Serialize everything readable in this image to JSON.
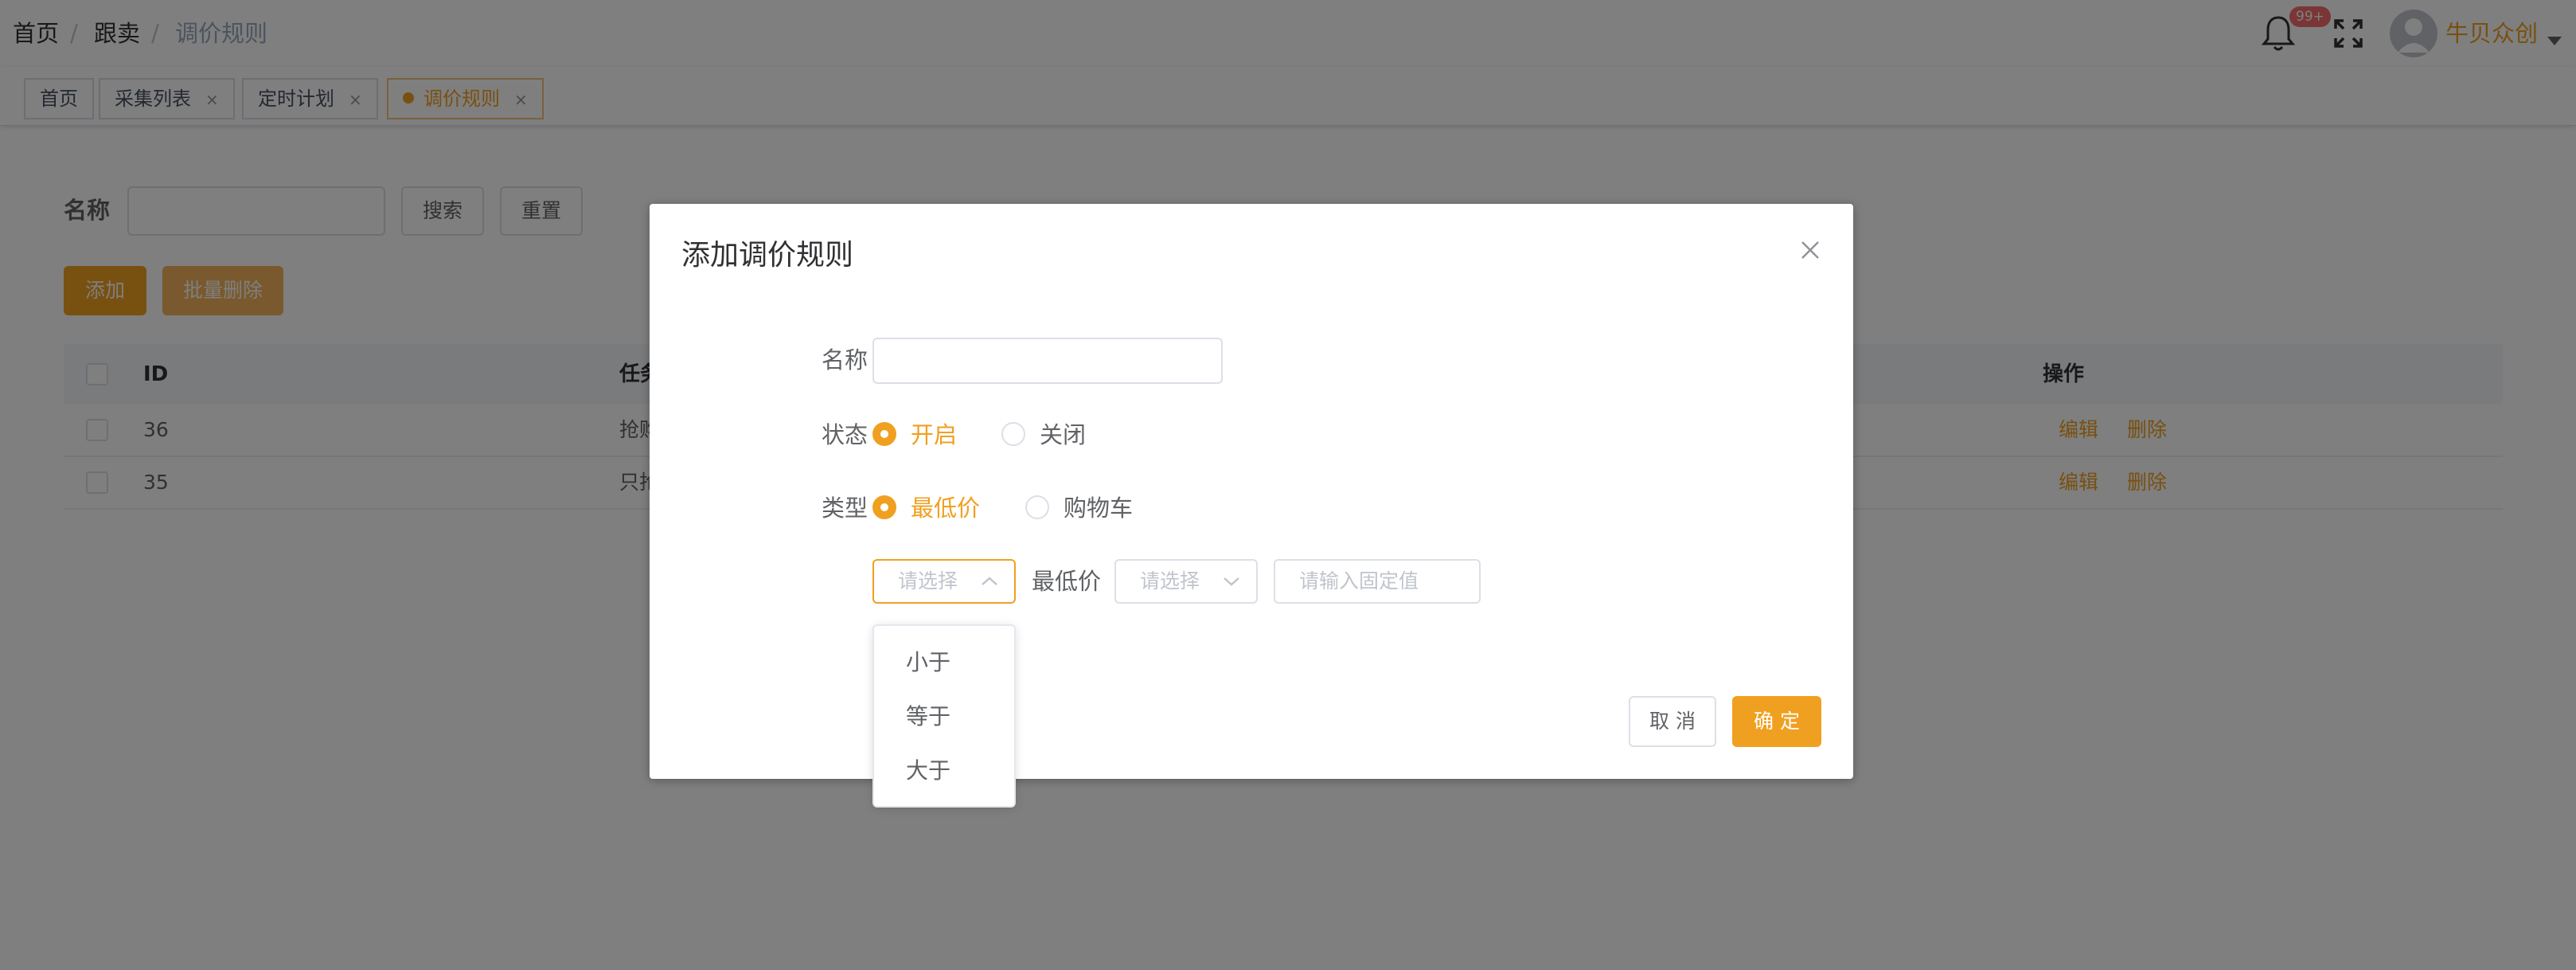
{
  "breadcrumb": {
    "home": "首页",
    "parent": "跟卖",
    "current": "调价规则",
    "separator": "/"
  },
  "header": {
    "notification_badge": "99+",
    "user_name": "牛贝众创"
  },
  "tags": [
    {
      "label": "首页"
    },
    {
      "label": "采集列表",
      "close": "×"
    },
    {
      "label": "定时计划",
      "close": "×"
    },
    {
      "label": "调价规则",
      "close": "×"
    }
  ],
  "filter": {
    "name_label": "名称",
    "name_value": "",
    "search_button": "搜索",
    "reset_button": "重置"
  },
  "toolbar": {
    "add_button": "添加",
    "batch_delete_button": "批量删除"
  },
  "table": {
    "columns": {
      "id": "ID",
      "task": "任务",
      "actions": "操作"
    },
    "rows": [
      {
        "id": "36",
        "task": "抢购",
        "edit": "编辑",
        "delete": "删除"
      },
      {
        "id": "35",
        "task": "只抢",
        "edit": "编辑",
        "delete": "删除"
      }
    ]
  },
  "dialog": {
    "title": "添加调价规则",
    "name_label": "名称",
    "name_value": "",
    "status_label": "状态",
    "status_options": [
      "开启",
      "关闭"
    ],
    "status_selected": "开启",
    "type_label": "类型",
    "type_options": [
      "最低价",
      "购物车"
    ],
    "type_selected": "最低价",
    "compare_placeholder": "请选择",
    "mid_label": "最低价",
    "second_placeholder": "请选择",
    "value_placeholder": "请输入固定值",
    "cancel_button": "取 消",
    "confirm_button": "确 定"
  },
  "dropdown": {
    "options": [
      "小于",
      "等于",
      "大于"
    ]
  },
  "colors": {
    "accent": "#f0a020",
    "badge": "#f56c6c",
    "overlay": "rgba(0,0,0,0.5)"
  }
}
